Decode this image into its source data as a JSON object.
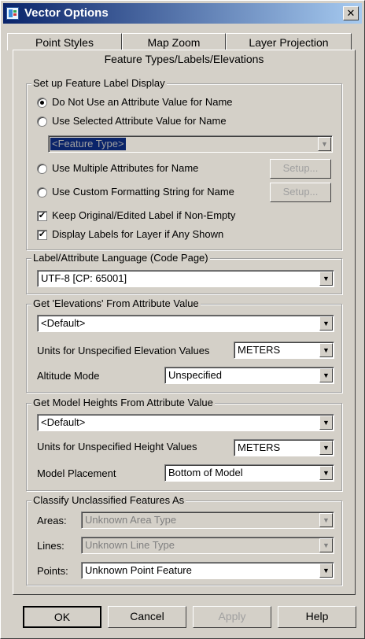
{
  "window": {
    "title": "Vector Options",
    "close_glyph": "✕"
  },
  "tabs": {
    "back_row": [
      "Point Styles",
      "Map Zoom",
      "Layer Projection"
    ],
    "active": "Feature Types/Labels/Elevations"
  },
  "label_display": {
    "group_title": "Set up Feature Label Display",
    "opt_no_attr": "Do Not Use an Attribute Value for Name",
    "opt_selected_attr": "Use Selected Attribute Value for Name",
    "attr_combo_value": "<Feature Type>",
    "opt_multiple": "Use Multiple Attributes for Name",
    "opt_custom": "Use Custom Formatting String for Name",
    "setup_label": "Setup...",
    "chk_keep_original": "Keep Original/Edited Label if Non-Empty",
    "chk_display_labels": "Display Labels for Layer if Any Shown",
    "selected_option": "opt_no_attr",
    "keep_original_checked": true,
    "display_labels_checked": true
  },
  "language": {
    "group_title": "Label/Attribute Language (Code Page)",
    "value": "UTF-8 [CP: 65001]"
  },
  "elevations": {
    "group_title": "Get 'Elevations' From Attribute Value",
    "attr_value": "<Default>",
    "units_label": "Units for Unspecified Elevation Values",
    "units_value": "METERS",
    "altitude_label": "Altitude Mode",
    "altitude_value": "Unspecified"
  },
  "model_heights": {
    "group_title": "Get Model Heights From Attribute Value",
    "attr_value": "<Default>",
    "units_label": "Units for Unspecified Height Values",
    "units_value": "METERS",
    "placement_label": "Model Placement",
    "placement_value": "Bottom of Model"
  },
  "classify": {
    "group_title": "Classify Unclassified Features As",
    "areas_label": "Areas:",
    "areas_value": "Unknown Area Type",
    "lines_label": "Lines:",
    "lines_value": "Unknown Line Type",
    "points_label": "Points:",
    "points_value": "Unknown Point Feature"
  },
  "footer": {
    "ok": "OK",
    "cancel": "Cancel",
    "apply": "Apply",
    "help": "Help"
  },
  "icons": {
    "dropdown": "▼",
    "check": "✔"
  }
}
